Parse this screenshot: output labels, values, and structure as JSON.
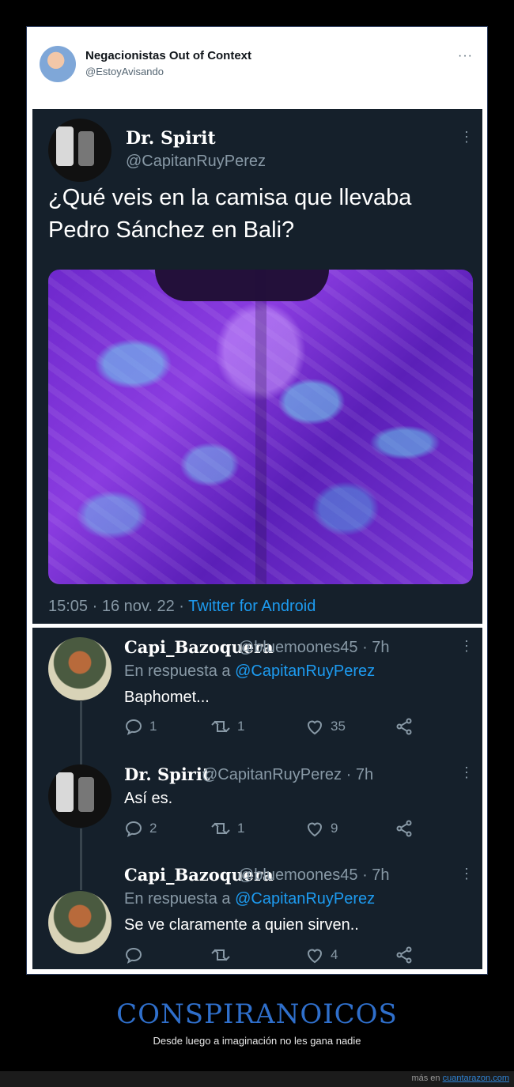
{
  "outer_tweet": {
    "name": "Negacionistas Out of Context",
    "handle": "@EstoyAvisando",
    "more": "···"
  },
  "main_tweet": {
    "name": "Dr. Spirit",
    "handle": "@CapitanRuyPerez",
    "text": "¿Qué veis en la camisa que llevaba Pedro Sánchez en Bali?",
    "time": "15:05 · 16 nov. 22 · ",
    "source": "Twitter for Android"
  },
  "replies": [
    {
      "name": "Capi_Bazoquera",
      "handle_meta": "@bluemoones45 · 7h",
      "reply_prefix": "En respuesta a ",
      "reply_to": "@CapitanRuyPerez",
      "text": "Baphomet...",
      "replies": "1",
      "retweets": "1",
      "likes": "35"
    },
    {
      "name": "Dr. Spirit",
      "handle_meta": "@CapitanRuyPerez · 7h",
      "text": "Así es.",
      "replies": "2",
      "retweets": "1",
      "likes": "9"
    },
    {
      "name": "Capi_Bazoquera",
      "handle_meta": "@bluemoones45 · 7h",
      "reply_prefix": "En respuesta a ",
      "reply_to": "@CapitanRuyPerez",
      "text": "Se ve claramente a quien sirven..",
      "replies": "",
      "retweets": "",
      "likes": "4"
    }
  ],
  "caption": {
    "title": "CONSPIRANOICOS",
    "subtitle": "Desde luego a imaginación no les gana nadie"
  },
  "footer": {
    "prefix": "más en ",
    "link": "cuantarazon.com"
  },
  "colors": {
    "tweet_bg": "#15202b",
    "accent": "#1d9bf0",
    "caption": "#2f6fcb"
  }
}
